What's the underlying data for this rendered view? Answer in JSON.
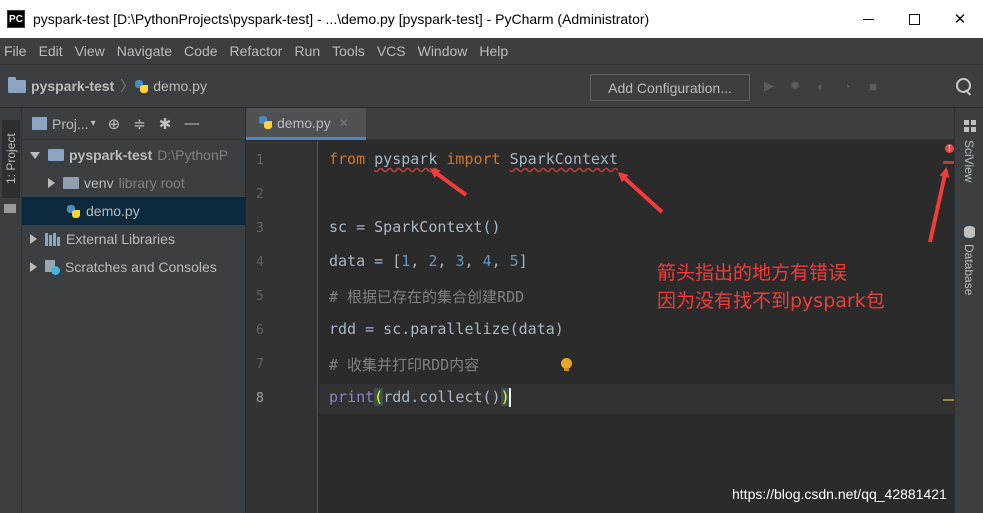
{
  "window": {
    "title": "pyspark-test [D:\\PythonProjects\\pyspark-test] - ...\\demo.py [pyspark-test] - PyCharm (Administrator)",
    "app_icon_label": "PC",
    "minimize_icon": "minimize-icon",
    "maximize_icon": "maximize-icon",
    "close_glyph": "✕"
  },
  "menu": [
    "File",
    "Edit",
    "View",
    "Navigate",
    "Code",
    "Refactor",
    "Run",
    "Tools",
    "VCS",
    "Window",
    "Help"
  ],
  "navbar": {
    "project": "pyspark-test",
    "separator": "〉",
    "file": "demo.py",
    "add_configuration": "Add Configuration...",
    "tool_icons": [
      "run-icon",
      "debug-icon",
      "coverage-icon",
      "profile-icon",
      "stop-icon"
    ],
    "tool_glyphs": [
      "▶",
      "✹",
      "◐",
      "◔",
      "■"
    ]
  },
  "left_stripe": {
    "tab": "1: Project"
  },
  "project_panel": {
    "label": "Proj...",
    "dropdown": "▾",
    "header_buttons": [
      "⊕",
      "≑",
      "✱",
      "—"
    ],
    "tree": [
      {
        "label": "pyspark-test",
        "hint": "D:\\PythonP",
        "bold": true,
        "arrow": "down",
        "icon": "folder"
      },
      {
        "label": "venv",
        "hint": "library root",
        "arrow": "right",
        "icon": "folder-dark"
      },
      {
        "label": "demo.py",
        "hint": "",
        "arrow": "",
        "icon": "python",
        "selected": true
      },
      {
        "label": "External Libraries",
        "hint": "",
        "arrow": "right",
        "icon": "library"
      },
      {
        "label": "Scratches and Consoles",
        "hint": "",
        "arrow": "right",
        "icon": "scratch"
      }
    ]
  },
  "editor": {
    "tab": {
      "label": "demo.py",
      "close": "✕"
    },
    "line_numbers": [
      "1",
      "2",
      "3",
      "4",
      "5",
      "6",
      "7",
      "8"
    ],
    "current_line": 8,
    "lines": [
      {
        "n": 1,
        "tokens": [
          {
            "t": "from",
            "c": "kw"
          },
          {
            "t": " "
          },
          {
            "t": "pyspark",
            "c": "err"
          },
          {
            "t": " "
          },
          {
            "t": "import",
            "c": "kw"
          },
          {
            "t": " "
          },
          {
            "t": "SparkContext",
            "c": "err"
          }
        ]
      },
      {
        "n": 2,
        "tokens": []
      },
      {
        "n": 3,
        "tokens": [
          {
            "t": "sc = SparkContext()"
          }
        ]
      },
      {
        "n": 4,
        "tokens": [
          {
            "t": "data = ["
          },
          {
            "t": "1",
            "c": "num"
          },
          {
            "t": ", "
          },
          {
            "t": "2",
            "c": "num"
          },
          {
            "t": ", "
          },
          {
            "t": "3",
            "c": "num"
          },
          {
            "t": ", "
          },
          {
            "t": "4",
            "c": "num"
          },
          {
            "t": ", "
          },
          {
            "t": "5",
            "c": "num"
          },
          {
            "t": "]"
          }
        ]
      },
      {
        "n": 5,
        "tokens": [
          {
            "t": "# 根据已存在的集合创建RDD",
            "c": "cmt"
          }
        ]
      },
      {
        "n": 6,
        "tokens": [
          {
            "t": "rdd = sc.parallelize(data)"
          }
        ]
      },
      {
        "n": 7,
        "tokens": [
          {
            "t": "# 收集并打印RDD内容",
            "c": "cmt"
          }
        ]
      },
      {
        "n": 8,
        "tokens": [
          {
            "t": "print",
            "c": "bi"
          },
          {
            "t": "(",
            "c": "paren-hl"
          },
          {
            "t": "rdd.collect()"
          },
          {
            "t": ")",
            "c": "paren-hl"
          }
        ]
      }
    ],
    "error_marker": "!"
  },
  "annotation": {
    "line1": "箭头指出的地方有错误",
    "line2": "因为没有找不到pyspark包",
    "color": "#f23b3b"
  },
  "right_stripe": {
    "tabs": [
      "SciView",
      "Database"
    ]
  },
  "watermark": "https://blog.csdn.net/qq_42881421",
  "colors": {
    "editor_bg": "#2b2b2b",
    "panel_bg": "#3c3f41",
    "keyword": "#cc7832",
    "number": "#6897bb",
    "comment": "#808080",
    "selection": "#0d293e",
    "accent": "#4a88c7"
  }
}
